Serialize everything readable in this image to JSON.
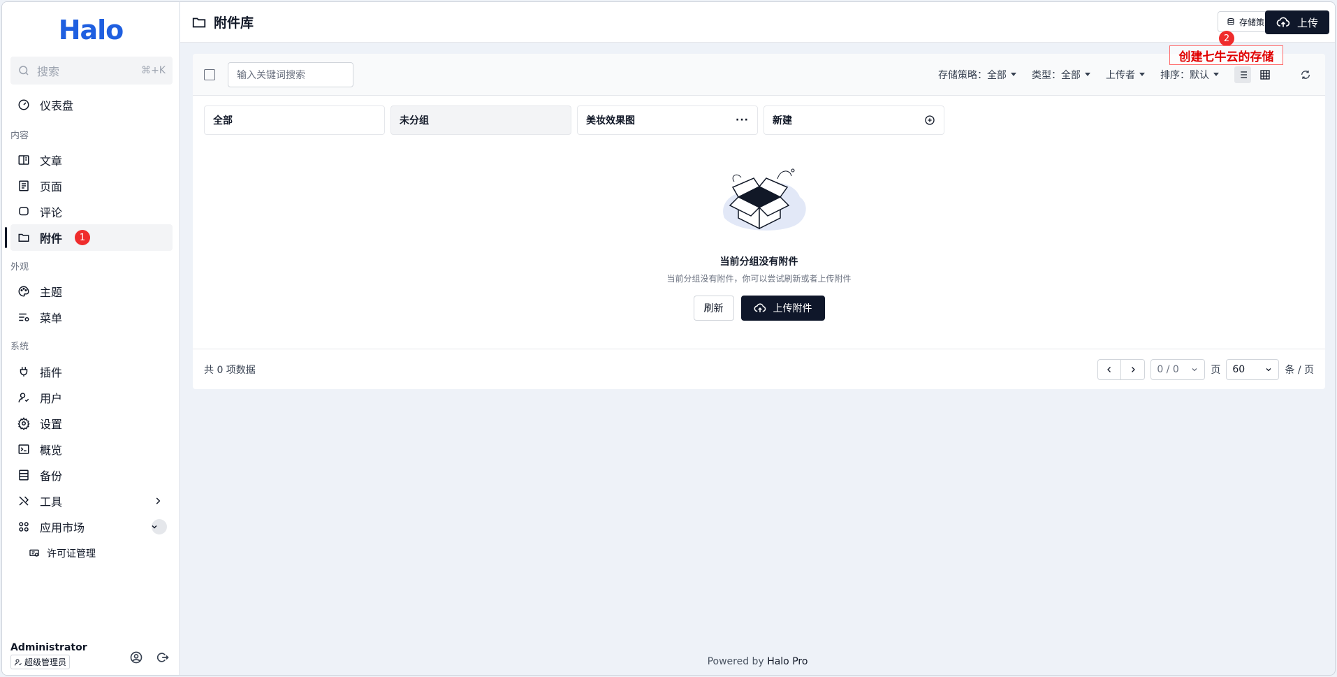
{
  "brand": {
    "logo": "Halo"
  },
  "sidebar": {
    "search": {
      "placeholder": "搜索",
      "shortcut": "⌘+K"
    },
    "dashboard": "仪表盘",
    "sections": {
      "content": "内容",
      "appearance": "外观",
      "system": "系统"
    },
    "items": {
      "posts": "文章",
      "pages": "页面",
      "comments": "评论",
      "attachments": "附件",
      "themes": "主题",
      "menus": "菜单",
      "plugins": "插件",
      "users": "用户",
      "settings": "设置",
      "overview": "概览",
      "backup": "备份",
      "tools": "工具",
      "market": "应用市场",
      "license": "许可证管理"
    },
    "attachments_badge": "1",
    "user": {
      "name": "Administrator",
      "role": "超级管理员"
    }
  },
  "header": {
    "title": "附件库",
    "policy_button": "存储策略",
    "upload_button": "上传"
  },
  "annotation": {
    "badge": "2",
    "text": "创建七牛云的存储"
  },
  "toolbar": {
    "keyword_placeholder": "输入关键词搜索",
    "filters": {
      "policy": "存储策略：全部",
      "type": "类型：全部",
      "uploader": "上传者",
      "sort": "排序：默认"
    }
  },
  "groups": [
    {
      "label": "全部"
    },
    {
      "label": "未分组"
    },
    {
      "label": "美妆效果图"
    },
    {
      "label": "新建"
    }
  ],
  "empty": {
    "title": "当前分组没有附件",
    "desc": "当前分组没有附件，你可以尝试刷新或者上传附件",
    "refresh": "刷新",
    "upload": "上传附件"
  },
  "footer": {
    "total": "共 0 项数据",
    "page_value": "0 / 0",
    "page_unit": "页",
    "size_value": "60",
    "size_unit": "条 / 页"
  },
  "powered": {
    "prefix": "Powered by",
    "brand": "Halo Pro"
  },
  "colors": {
    "accent": "#0f172a",
    "logo": "#1f5fe0",
    "badge": "#ef2c2c",
    "annotation": "#e00000"
  }
}
